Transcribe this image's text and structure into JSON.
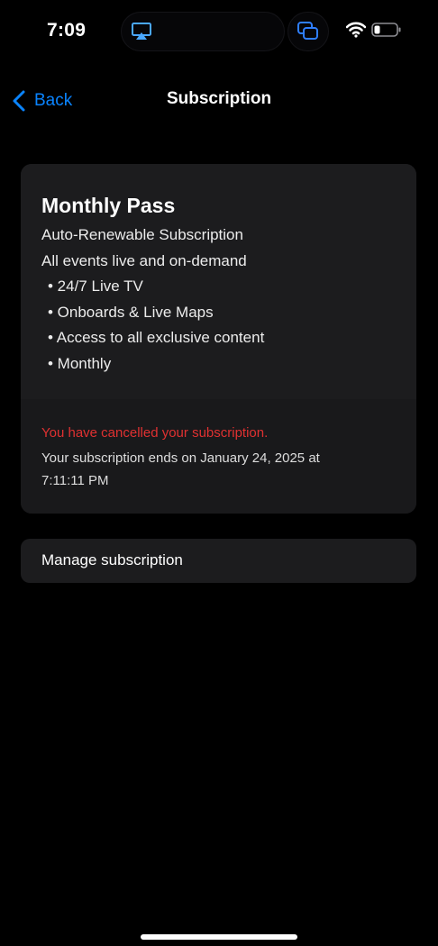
{
  "status_bar": {
    "time": "7:09",
    "icons": [
      "airplay-icon",
      "screen-mirroring-icon",
      "wifi-icon",
      "battery-icon"
    ]
  },
  "nav": {
    "back_label": "Back",
    "title": "Subscription",
    "accent_color": "#0a84ff"
  },
  "plan": {
    "title": "Monthly Pass",
    "type": "Auto-Renewable Subscription",
    "description": "All events live and on-demand",
    "features": [
      "• 24/7 Live TV",
      "• Onboards & Live Maps",
      "• Access to all exclusive content",
      "• Monthly"
    ]
  },
  "status": {
    "cancelled_message": "You have cancelled your subscription.",
    "cancelled_color": "#e03131",
    "ends_message": "Your subscription ends on January 24, 2025 at 7:11:11 PM"
  },
  "actions": {
    "manage_label": "Manage subscription"
  }
}
